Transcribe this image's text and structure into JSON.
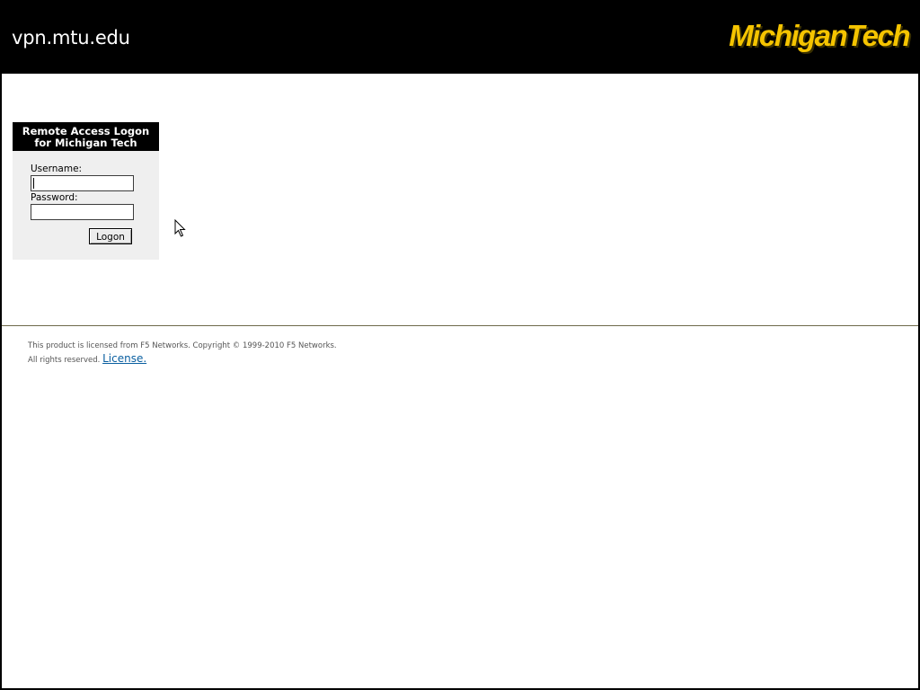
{
  "header": {
    "site_name": "vpn.mtu.edu",
    "logo_text": "MichiganTech",
    "logo_color": "#f5c400"
  },
  "logon": {
    "title_line1": "Remote Access Logon",
    "title_line2": "for Michigan Tech",
    "username_label": "Username:",
    "username_value": "",
    "password_label": "Password:",
    "password_value": "",
    "button_label": "Logon"
  },
  "footer": {
    "line1": "This product is licensed from F5 Networks. Copyright © 1999-2010 F5 Networks.",
    "line2": "All rights reserved.",
    "license_link": "License."
  },
  "colors": {
    "header_bg": "#000000",
    "content_bg": "#ffffff",
    "box_bg": "#efefef",
    "link": "#0a5fa0"
  }
}
